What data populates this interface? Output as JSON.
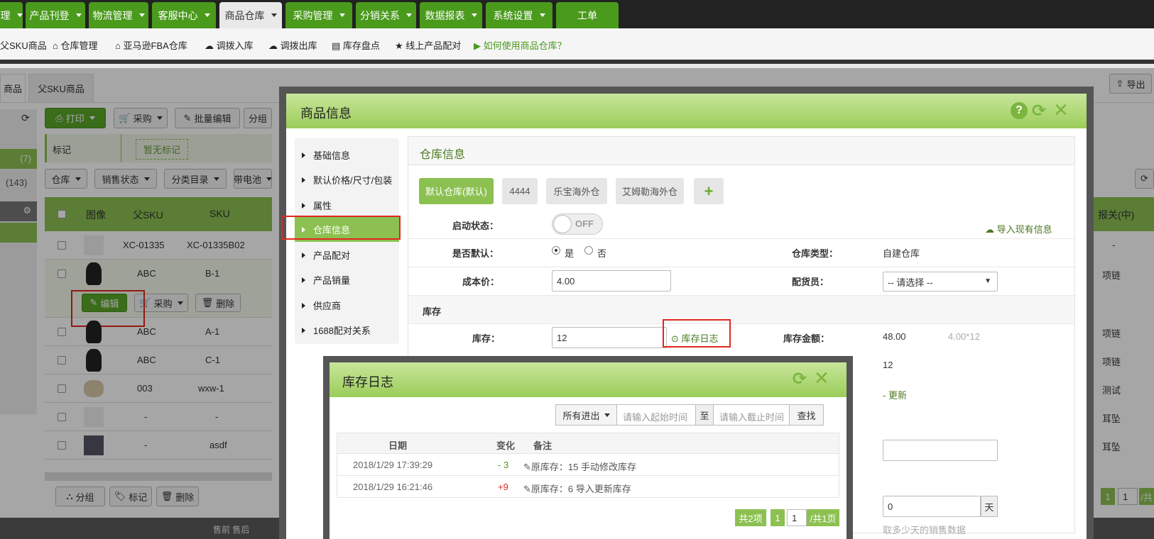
{
  "topnav": {
    "tabs": [
      {
        "label": "理"
      },
      {
        "label": "产品刊登"
      },
      {
        "label": "物流管理"
      },
      {
        "label": "客服中心"
      },
      {
        "label": "商品仓库"
      },
      {
        "label": "采购管理"
      },
      {
        "label": "分销关系"
      },
      {
        "label": "数据报表"
      },
      {
        "label": "系统设置"
      },
      {
        "label": "工单"
      }
    ]
  },
  "subnav": {
    "items": [
      {
        "label": "父SKU商品"
      },
      {
        "label": "仓库管理"
      },
      {
        "label": "亚马逊FBA仓库"
      },
      {
        "label": "调拨入库"
      },
      {
        "label": "调拨出库"
      },
      {
        "label": "库存盘点"
      },
      {
        "label": "线上产品配对"
      },
      {
        "label": "如何使用商品仓库？"
      }
    ]
  },
  "bg": {
    "tabs": [
      "商品",
      "父SKU商品"
    ],
    "toolbar": {
      "print": "打印",
      "purchase": "采购",
      "batch_edit": "批量编辑",
      "group": "分组"
    },
    "tag_label": "标记",
    "tag_value": "暂无标记",
    "filters": [
      "仓库",
      "销售状态",
      "分类目录",
      "带电池"
    ],
    "left_counts": [
      "(7)",
      "(143)"
    ],
    "headers": {
      "image": "图像",
      "parent_sku": "父SKU",
      "sku": "SKU",
      "right": "报关(中)"
    },
    "rows": [
      {
        "parent": "XC-01335",
        "sku": "XC-01335B02",
        "right": "-"
      },
      {
        "parent": "ABC",
        "sku": "B-1",
        "right": "项链"
      },
      {
        "parent": "ABC",
        "sku": "A-1",
        "right": "项链"
      },
      {
        "parent": "ABC",
        "sku": "C-1",
        "right": "项链"
      },
      {
        "parent": "003",
        "sku": "wxw-1",
        "right": "测试"
      },
      {
        "parent": "-",
        "sku": "-",
        "right": "耳坠"
      },
      {
        "parent": "-",
        "sku": "asdf",
        "right": "耳坠"
      }
    ],
    "row_actions": {
      "edit": "编辑",
      "purchase": "采购",
      "delete": "删除"
    },
    "bottom": {
      "group": "分组",
      "tag": "标记",
      "delete": "删除"
    },
    "top_right": {
      "export": "导出"
    },
    "page_num": "1",
    "page_input": "1",
    "page_total": "/共"
  },
  "modal": {
    "title": "商品信息",
    "menu": [
      "基础信息",
      "默认价格/尺寸/包装",
      "属性",
      "仓库信息",
      "产品配对",
      "产品销量",
      "供应商",
      "1688配对关系"
    ],
    "section_title": "仓库信息",
    "warehouses": [
      "默认仓库(默认)",
      "4444",
      "乐宝海外仓",
      "艾姆勒海外仓"
    ],
    "add": "+",
    "enable_label": "启动状态：",
    "toggle": "OFF",
    "import_link": "导入现有信息",
    "default_label": "是否默认：",
    "yes": "是",
    "no": "否",
    "wh_type_label": "仓库类型：",
    "wh_type": "自建仓库",
    "cost_label": "成本价：",
    "cost": "4.00",
    "picker_label": "配货员：",
    "picker": "-- 请选择 --",
    "stock_section": "库存",
    "stock_label": "库存：",
    "stock": "12",
    "stock_log": "库存日志",
    "amount_label": "库存金额：",
    "amount": "48.00",
    "amount_formula": "4.00*12",
    "qty2": "12",
    "update": "- 更新",
    "days_value": "0",
    "days_unit": "天",
    "days_hint": "取多少天的销售数据"
  },
  "log": {
    "title": "库存日志",
    "filter": "所有进出",
    "start_placeholder": "请输入起始时间",
    "to": "至",
    "end_placeholder": "请输入截止时间",
    "search": "查找",
    "cols": {
      "date": "日期",
      "change": "变化",
      "note": "备注"
    },
    "rows": [
      {
        "date": "2018/1/29 17:39:29",
        "change": "- 3",
        "note": "原库存：15 手动修改库存"
      },
      {
        "date": "2018/1/29 16:21:46",
        "change": "+9",
        "note": "原库存：6 导入更新库存"
      }
    ],
    "total": "共2项",
    "page": "1",
    "page_input": "1",
    "page_total": "/共1页"
  },
  "footer_text": "售前  售后"
}
